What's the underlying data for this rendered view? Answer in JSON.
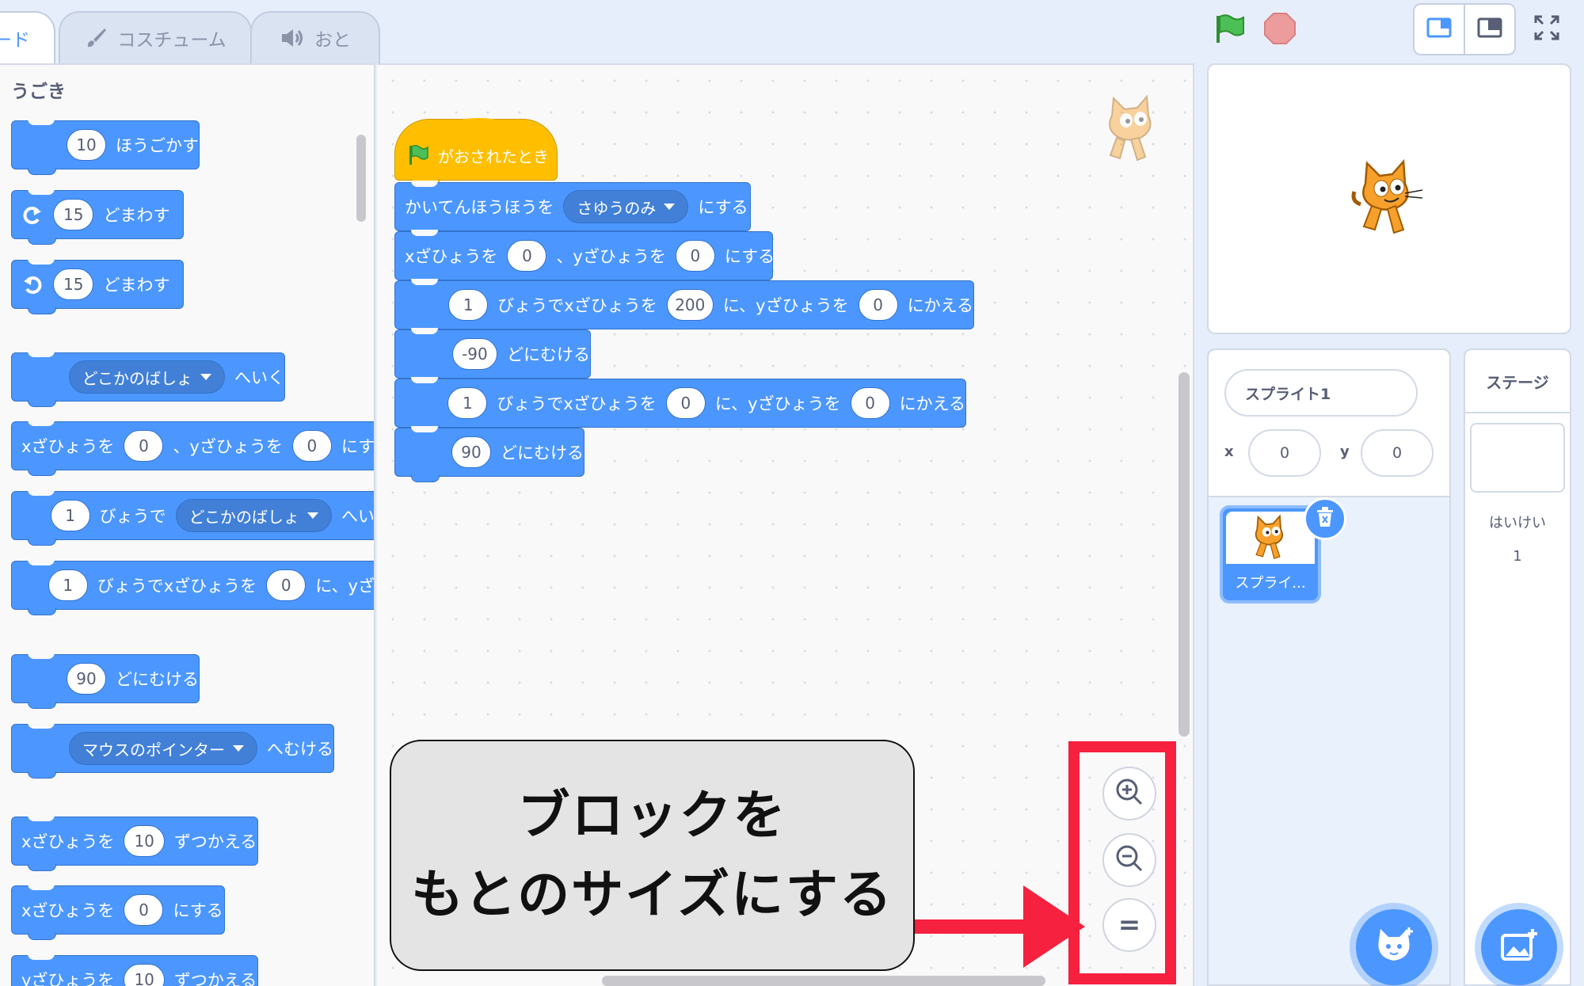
{
  "tabs": {
    "code": "ード",
    "costumes": "コスチューム",
    "sounds": "おと"
  },
  "palette": {
    "category": "うごき",
    "blocks": {
      "move_steps": "10",
      "move_label": "ほうごかす",
      "turn_right_val": "15",
      "turn_right_label": "どまわす",
      "turn_left_val": "15",
      "turn_left_label": "どまわす",
      "goto_menu": "どこかのばしょ",
      "goto_label": "へいく",
      "gotoxy_x_label": "xざひょうを",
      "gotoxy_x": "0",
      "gotoxy_y_label": "、yざひょうを",
      "gotoxy_y": "0",
      "gotoxy_end": "にする",
      "glide_secs": "1",
      "glide_label": "びょうで",
      "glide_menu": "どこかのばしょ",
      "glide_end": "へい",
      "glidexy_secs": "1",
      "glidexy_label": "びょうでxざひょうを",
      "glidexy_x": "0",
      "glidexy_y_label": "に、yざ",
      "point_dir": "90",
      "point_label": "どにむける",
      "point_towards_menu": "マウスのポインター",
      "point_towards_label": "へむける",
      "change_x_label": "xざひょうを",
      "change_x": "10",
      "change_x_end": "ずつかえる",
      "set_x_label": "xざひょうを",
      "set_x": "0",
      "set_x_end": "にする",
      "change_y_label": "yざひょうを",
      "change_y": "10",
      "change_y_end": "ずつかえる"
    }
  },
  "script": {
    "hat_label": "がおされたとき",
    "rot_label": "かいてんほうほうを",
    "rot_menu": "さゆうのみ",
    "rot_end": "にする",
    "goto_x_label": "xざひょうを",
    "goto_x": "0",
    "goto_y_label": "、yざひょうを",
    "goto_y": "0",
    "goto_end": "にする",
    "glide1_secs": "1",
    "glide1_label": "びょうでxざひょうを",
    "glide1_x": "200",
    "glide1_mid": "に、yざひょうを",
    "glide1_y": "0",
    "glide1_end": "にかえる",
    "point1_val": "-90",
    "point1_label": "どにむける",
    "glide2_secs": "1",
    "glide2_label": "びょうでxざひょうを",
    "glide2_x": "0",
    "glide2_mid": "に、yざひょうを",
    "glide2_y": "0",
    "glide2_end": "にかえる",
    "point2_val": "90",
    "point2_label": "どにむける"
  },
  "callout": {
    "line1": "ブロックを",
    "line2": "もとのサイズにする"
  },
  "zoom": {
    "reset_glyph": "="
  },
  "sprite_info": {
    "name": "スプライト1",
    "x_label": "x",
    "x": "0",
    "y_label": "y",
    "y": "0"
  },
  "sprite_list": {
    "sprite_name": "スプライ..."
  },
  "stage_panel": {
    "title": "ステージ",
    "backdrops_label": "はいけい",
    "backdrops_count": "1"
  },
  "colors": {
    "motion": "#4c97ff",
    "events": "#ffbf00",
    "highlight": "#f5213f"
  },
  "icons": [
    "green-flag-icon",
    "stop-icon",
    "zoom-in-icon",
    "zoom-out-icon",
    "sprite-cat-icon",
    "trash-icon",
    "add-sprite-icon",
    "add-backdrop-icon",
    "brush-icon",
    "speaker-icon",
    "fullscreen-icon",
    "small-stage-icon",
    "large-stage-icon",
    "turn-right-icon",
    "turn-left-icon"
  ]
}
